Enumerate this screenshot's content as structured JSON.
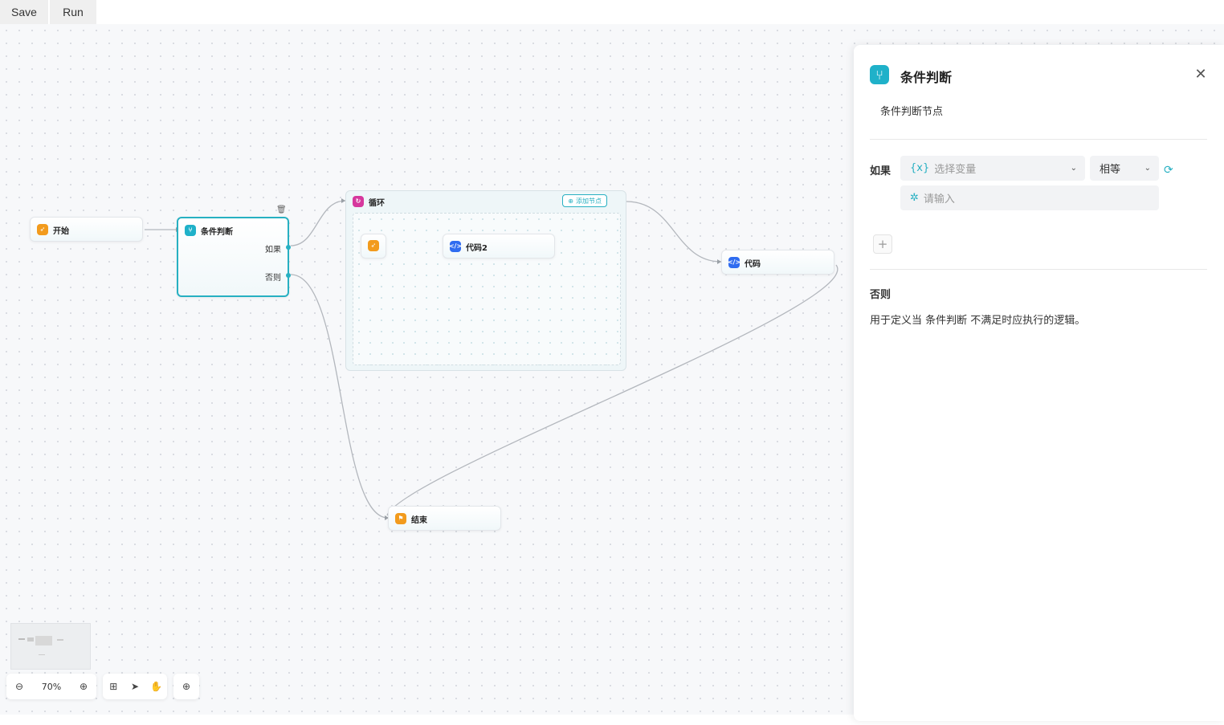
{
  "toolbar": {
    "save_label": "Save",
    "run_label": "Run"
  },
  "nodes": {
    "start": {
      "title": "开始",
      "icon": "rocket-icon"
    },
    "condition": {
      "title": "条件判断",
      "icon": "branch-icon",
      "if_label": "如果",
      "else_label": "否则"
    },
    "loop": {
      "title": "循环",
      "icon": "loop-icon",
      "add_node_label": "添加节点"
    },
    "code2": {
      "title": "代码2",
      "icon": "code-icon"
    },
    "code": {
      "title": "代码",
      "icon": "code-icon"
    },
    "end": {
      "title": "结束",
      "icon": "flag-icon"
    }
  },
  "panel": {
    "title": "条件判断",
    "description": "条件判断节点",
    "if_label": "如果",
    "variable_placeholder": "选择变量",
    "variable_prefix": "{x}",
    "operator_value": "相等",
    "value_placeholder": "请输入",
    "add_label": "+",
    "else_title": "否则",
    "else_description": "用于定义当 条件判断 不满足时应执行的逻辑。"
  },
  "zoom": {
    "level": "70%"
  },
  "colors": {
    "accent": "#27b0c2",
    "start_icon": "#f29b1d",
    "code_icon": "#2f6cf0",
    "loop_icon": "#d6389d"
  }
}
